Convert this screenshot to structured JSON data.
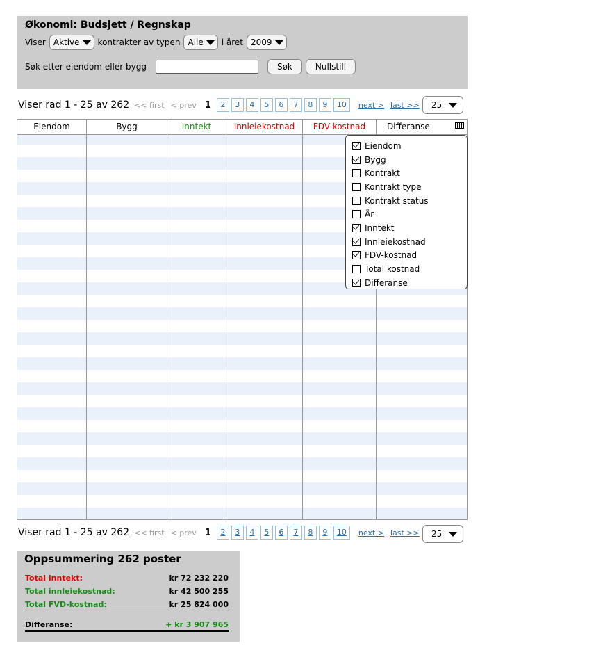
{
  "filter": {
    "title": "Økonomi: Budsjett / Regnskap",
    "viser_label": "Viser",
    "status_value": "Aktive",
    "kontrakter_label": "kontrakter av typen",
    "type_value": "Alle",
    "year_label": "i året",
    "year_value": "2009",
    "search_label": "Søk etter eiendom eller bygg",
    "search_value": "",
    "search_button": "Søk",
    "reset_button": "Nullstill"
  },
  "pager": {
    "info": "Viser rad 1 - 25 av 262",
    "first": "<< first",
    "prev": "< prev",
    "current": "1",
    "pages": [
      "2",
      "3",
      "4",
      "5",
      "6",
      "7",
      "8",
      "9",
      "10"
    ],
    "next": "next >",
    "last": "last >>",
    "page_size": "25"
  },
  "table": {
    "columns": [
      {
        "label": "Eiendom",
        "color": "#000000"
      },
      {
        "label": "Bygg",
        "color": "#000000"
      },
      {
        "label": "Inntekt",
        "color": "#1a8a1a"
      },
      {
        "label": "Innleiekostnad",
        "color": "#e00000"
      },
      {
        "label": "FDV-kostnad",
        "color": "#e00000"
      },
      {
        "label": "Differanse",
        "color": "#000000"
      }
    ],
    "column_chooser_icon": "column-chooser-icon"
  },
  "column_chooser": {
    "items": [
      {
        "label": "Eiendom",
        "checked": true
      },
      {
        "label": "Bygg",
        "checked": true
      },
      {
        "label": "Kontrakt",
        "checked": false
      },
      {
        "label": "Kontrakt type",
        "checked": false
      },
      {
        "label": "Kontrakt status",
        "checked": false
      },
      {
        "label": "År",
        "checked": false
      },
      {
        "label": "Inntekt",
        "checked": true
      },
      {
        "label": "Innleiekostnad",
        "checked": true
      },
      {
        "label": "FDV-kostnad",
        "checked": true
      },
      {
        "label": "Total kostnad",
        "checked": false
      },
      {
        "label": "Differanse",
        "checked": true
      }
    ]
  },
  "summary": {
    "title": "Oppsummering 262 poster",
    "rows": [
      {
        "label": "Total inntekt:",
        "value": "kr 72 232 220",
        "color": "#e00000"
      },
      {
        "label": "Total innleiekostnad:",
        "value": "kr 42 500 255",
        "color": "#1a8a1a"
      },
      {
        "label": "Total FVD-kostnad:",
        "value": "kr 25 824 000",
        "color": "#1a8a1a"
      }
    ],
    "diff_label": "Differanse:",
    "diff_value": "+ kr 3 907 965",
    "diff_color": "#1a8a1a"
  }
}
